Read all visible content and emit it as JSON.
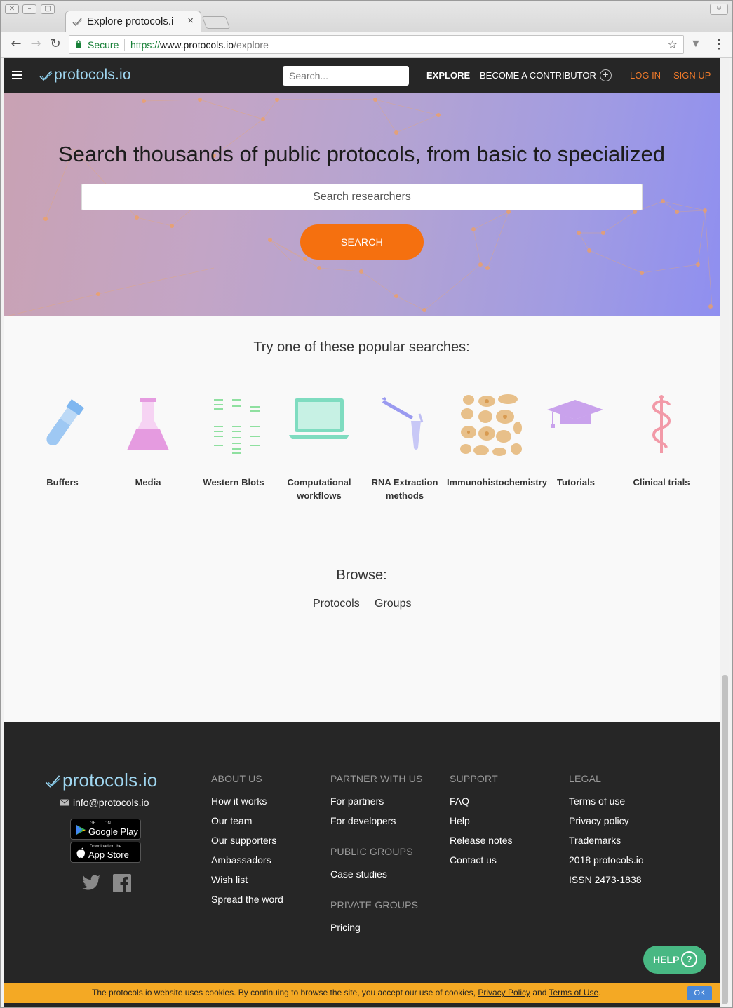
{
  "browser": {
    "tab_title": "Explore protocols.i",
    "tab_close": "×",
    "secure_label": "Secure",
    "url_scheme": "https://",
    "url_host": "www.protocols.io",
    "url_path": "/explore"
  },
  "header": {
    "logo_text": "protocols.io",
    "search_placeholder": "Search...",
    "nav": {
      "explore": "EXPLORE",
      "become_contributor": "BECOME A CONTRIBUTOR",
      "plus": "+",
      "log_in": "LOG IN",
      "sign_up": "SIGN UP"
    }
  },
  "hero": {
    "title": "Search thousands of public protocols, from basic to specialized",
    "search_placeholder": "Search researchers",
    "search_button": "SEARCH"
  },
  "popular": {
    "title": "Try one of these popular searches:",
    "categories": [
      {
        "label": "Buffers",
        "icon": "test-tube-icon"
      },
      {
        "label": "Media",
        "icon": "flask-icon"
      },
      {
        "label": "Western Blots",
        "icon": "western-blot-icon"
      },
      {
        "label": "Computational workflows",
        "icon": "laptop-icon"
      },
      {
        "label": "RNA Extraction methods",
        "icon": "pipette-icon"
      },
      {
        "label": "Immunohistochemistry",
        "icon": "tissue-icon"
      },
      {
        "label": "Tutorials",
        "icon": "graduation-cap-icon"
      },
      {
        "label": "Clinical trials",
        "icon": "caduceus-icon"
      }
    ]
  },
  "browse": {
    "title": "Browse:",
    "links": [
      "Protocols",
      "Groups"
    ]
  },
  "footer": {
    "logo_text": "protocols.io",
    "email": "info@protocols.io",
    "google_play": {
      "small": "GET IT ON",
      "big": "Google Play"
    },
    "app_store": {
      "small": "Download on the",
      "big": "App Store"
    },
    "about": {
      "heading": "ABOUT US",
      "links": [
        "How it works",
        "Our team",
        "Our supporters",
        "Ambassadors",
        "Wish list",
        "Spread the word"
      ]
    },
    "partner": {
      "heading": "PARTNER WITH US",
      "links": [
        "For partners",
        "For developers"
      ]
    },
    "public_groups": {
      "heading": "PUBLIC GROUPS",
      "links": [
        "Case studies"
      ]
    },
    "private_groups": {
      "heading": "PRIVATE GROUPS",
      "links": [
        "Pricing"
      ]
    },
    "support": {
      "heading": "SUPPORT",
      "links": [
        "FAQ",
        "Help",
        "Release notes",
        "Contact us"
      ]
    },
    "legal": {
      "heading": "LEGAL",
      "links": [
        "Terms of use",
        "Privacy policy",
        "Trademarks",
        "2018 protocols.io",
        "ISSN 2473-1838"
      ]
    }
  },
  "help_button": {
    "label": "HELP",
    "icon": "?"
  },
  "cookie": {
    "text_before": "The protocols.io website uses cookies. By continuing to browse the site, you accept our use of cookies,",
    "privacy_link": "Privacy Policy",
    "and": "and",
    "terms_link": "Terms of Use",
    "period": ".",
    "ok": "OK"
  },
  "colors": {
    "header_bg": "#262626",
    "logo": "#9fd6f0",
    "orange": "#f07a2a",
    "search_button": "#f5700f",
    "help_green": "#48b883",
    "cookie_bar": "#f4a924"
  }
}
